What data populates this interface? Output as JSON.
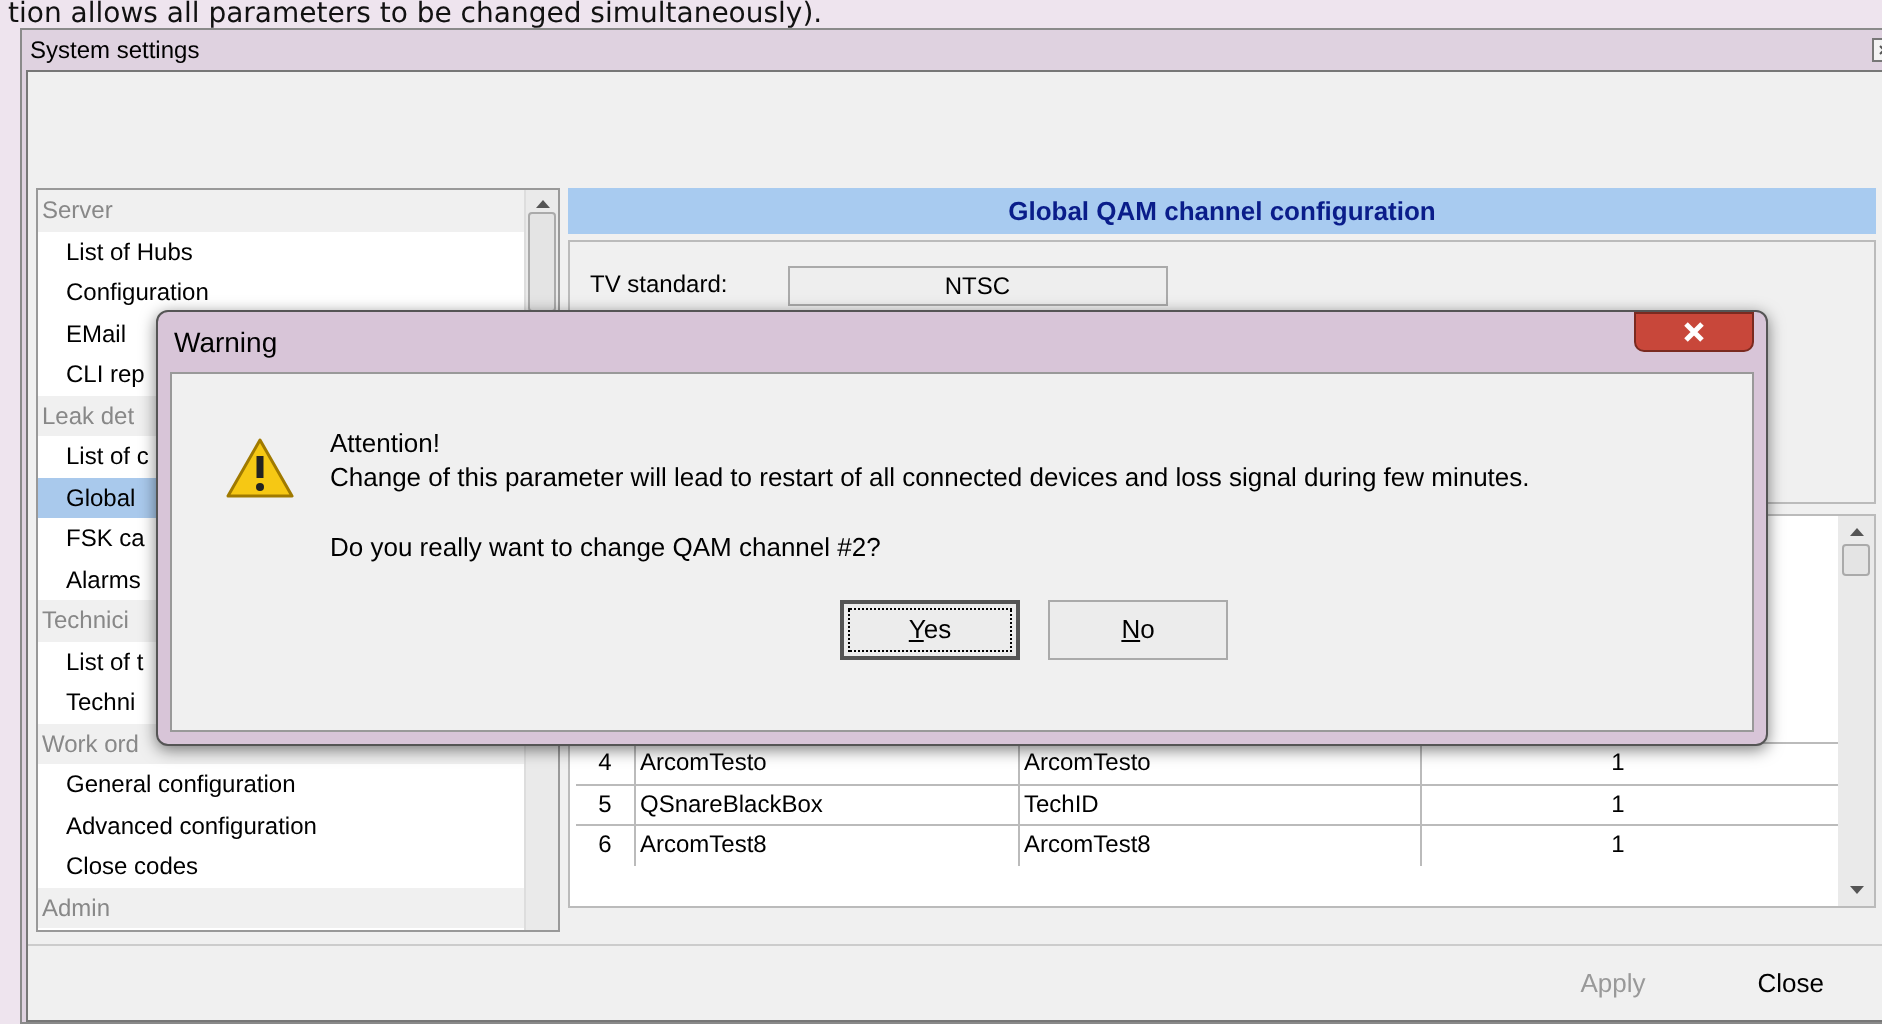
{
  "caption": "tion allows all parameters to be changed simultaneously).",
  "window": {
    "title": "System settings"
  },
  "sidebar": {
    "groups": [
      {
        "label": "Server",
        "children": [
          {
            "label": "List of Hubs",
            "selected": false
          },
          {
            "label": "Configuration",
            "selected": false
          },
          {
            "label": "EMail",
            "selected": false
          },
          {
            "label": "CLI rep",
            "selected": false
          }
        ]
      },
      {
        "label": "Leak det",
        "children": [
          {
            "label": "List of c",
            "selected": false
          },
          {
            "label": "Global",
            "selected": true
          },
          {
            "label": "FSK ca",
            "selected": false
          },
          {
            "label": "Alarms",
            "selected": false
          }
        ]
      },
      {
        "label": "Technici",
        "children": [
          {
            "label": "List of t",
            "selected": false
          },
          {
            "label": "Techni",
            "selected": false
          }
        ]
      },
      {
        "label": "Work ord",
        "children": [
          {
            "label": "General configuration",
            "selected": false
          },
          {
            "label": "Advanced configuration",
            "selected": false
          },
          {
            "label": "Close codes",
            "selected": false
          }
        ]
      },
      {
        "label": "Admin"
      }
    ]
  },
  "panel": {
    "title": "Global QAM channel configuration",
    "tv_standard": {
      "label": "TV standard:",
      "value": "NTSC"
    }
  },
  "table": {
    "rows": [
      {
        "number": "4",
        "column_2": "ArcomTesto",
        "column_3": "ArcomTesto",
        "column_4": "1"
      },
      {
        "number": "5",
        "column_2": "QSnareBlackBox",
        "column_3": "TechID",
        "column_4": "1"
      },
      {
        "number": "6",
        "column_2": "ArcomTest8",
        "column_3": "ArcomTest8",
        "column_4": "1"
      }
    ]
  },
  "footer": {
    "buttons": [
      {
        "label": "Apply",
        "disabled": true
      },
      {
        "label": "Close",
        "disabled": false
      }
    ]
  },
  "dialog": {
    "title": "Warning",
    "heading": "Attention!",
    "message": "Change of this parameter will lead to restart of all connected devices and loss signal during few minutes.",
    "question": "Do you really want to change QAM channel #2?",
    "buttons": [
      {
        "label": "Yes",
        "default": true
      },
      {
        "label": "No",
        "default": false
      }
    ]
  }
}
